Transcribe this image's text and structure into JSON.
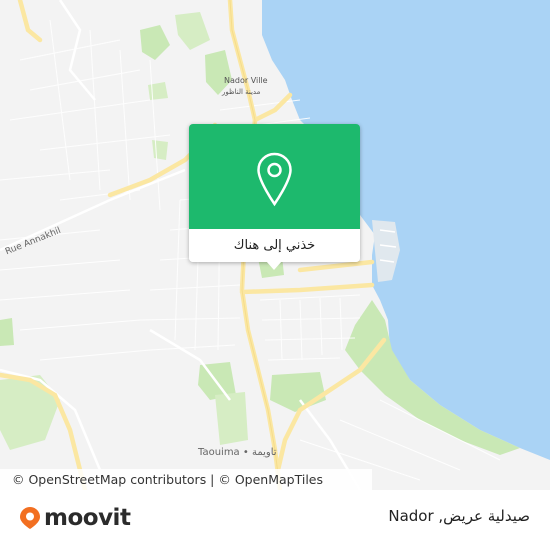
{
  "map": {
    "labels": {
      "nador_ville_fr": "Nador Ville",
      "nador_ville_ar": "مدينة الناظور",
      "road_annakhil": "Rue Annakhil",
      "taouima": "Taouima • تاويمة"
    },
    "colors": {
      "sea": "#aad3f5",
      "land": "#f3f3f3",
      "park": "#c9e8b5",
      "road_major": "#fbe7a2",
      "road_minor": "#ffffff"
    }
  },
  "popup": {
    "action_label": "خذني إلى هناك",
    "icon": "location-pin-icon",
    "color": "#1db96d"
  },
  "attribution": {
    "text": "© OpenStreetMap contributors | © OpenMapTiles"
  },
  "footer": {
    "brand": "moovit",
    "brand_color": "#f26f21",
    "place_name": "صيدلية عريض, Nador"
  }
}
